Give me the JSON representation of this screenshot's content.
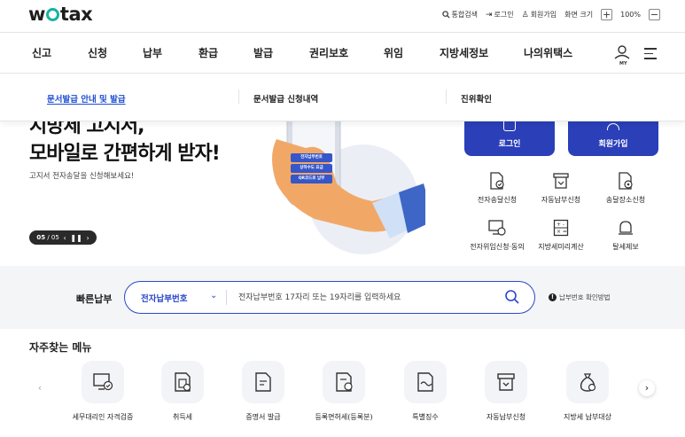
{
  "header": {
    "logo": "wetax",
    "utility": [
      {
        "icon": "search-icon",
        "label": "통합검색"
      },
      {
        "icon": "login-icon",
        "label": "로그인"
      },
      {
        "icon": "user-plus-icon",
        "label": "회원가입"
      }
    ],
    "zoom_label": "화면 크기",
    "zoom_in": "+",
    "zoom_value": "100%",
    "zoom_out": "−"
  },
  "gnb": {
    "items": [
      "신고",
      "신청",
      "납부",
      "환급",
      "발급",
      "권리보호",
      "위임",
      "지방세정보",
      "나의위택스"
    ],
    "my_label": "MY"
  },
  "submenu": {
    "items": [
      "문서발급 안내 및 발급",
      "문서발급 신청내역",
      "진위확인"
    ],
    "active": "문서발급 안내 및 발급"
  },
  "hero": {
    "headline_1": "지방세 고지서,",
    "headline_2": "모바일로 간편하게 받자!",
    "description": "고지서 전자송달을 신청해보세요!",
    "pager_current": "05",
    "pager_total": "/ 05",
    "phone_buttons": [
      "전자납부번호",
      "상하수도 요금",
      "QR코드로 납부"
    ],
    "login_label": "로그인",
    "join_label": "회원가입",
    "quick_links": [
      {
        "icon": "document-check-icon",
        "label": "전자송달신청"
      },
      {
        "icon": "auto-pay-icon",
        "label": "자동납부신청"
      },
      {
        "icon": "document-location-icon",
        "label": "송달장소신청"
      },
      {
        "icon": "monitor-delegate-icon",
        "label": "전자위임신청·동의"
      },
      {
        "icon": "calculator-icon",
        "label": "지방세미리계산"
      },
      {
        "icon": "bell-report-icon",
        "label": "탈세제보"
      }
    ]
  },
  "fastpay": {
    "label": "빠른납부",
    "select_value": "전자납부번호",
    "placeholder": "전자납부번호 17자리 또는 19자리를 입력하세요",
    "help": "납부번호 확인방법"
  },
  "frequent": {
    "title": "자주찾는 메뉴",
    "items": [
      {
        "icon": "monitor-check-icon",
        "label": "세무대리인 자격검증"
      },
      {
        "icon": "building-doc-icon",
        "label": "취득세"
      },
      {
        "icon": "certificate-icon",
        "label": "증명서 발급"
      },
      {
        "icon": "license-doc-icon",
        "label": "등록면허세(등록분)"
      },
      {
        "icon": "special-collect-icon",
        "label": "특별징수"
      },
      {
        "icon": "auto-pay-icon",
        "label": "자동납부신청"
      },
      {
        "icon": "money-bag-icon",
        "label": "지방세 납부대상"
      }
    ]
  },
  "colors": {
    "brand_teal": "#16b3a0",
    "primary_blue": "#2a3fb8",
    "link_blue": "#1f4fd1"
  }
}
